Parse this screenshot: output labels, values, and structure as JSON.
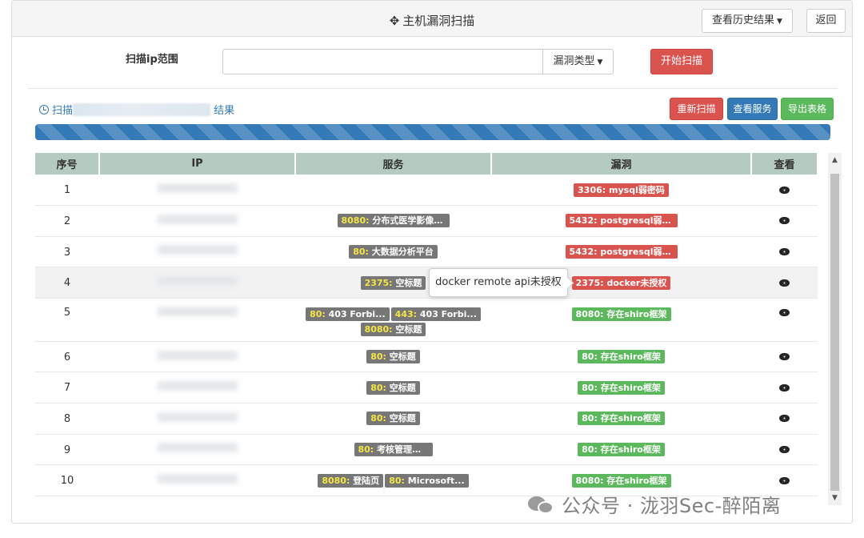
{
  "header": {
    "title": "主机漏洞扫描",
    "history_label": "查看历史结果",
    "back_label": "返回"
  },
  "scan_form": {
    "range_label": "扫描ip范围",
    "ip_value": "",
    "vuln_type_label": "漏洞类型",
    "start_label": "开始扫描"
  },
  "results": {
    "title_prefix": "扫描",
    "title_suffix": "结果",
    "rescan_label": "重新扫描",
    "services_label": "查看服务",
    "export_label": "导出表格",
    "progress_fraction": 1.0
  },
  "table": {
    "headers": [
      "序号",
      "IP",
      "服务",
      "漏洞",
      "查看"
    ],
    "rows": [
      {
        "idx": "1",
        "services": [],
        "vulns": [
          {
            "port": "3306:",
            "name": "mysql弱密码",
            "color": "red"
          }
        ]
      },
      {
        "idx": "2",
        "services": [
          {
            "port": "8080:",
            "name": "分布式医学影像平台"
          }
        ],
        "vulns": [
          {
            "port": "5432:",
            "name": "postgresql弱密码",
            "color": "red"
          }
        ]
      },
      {
        "idx": "3",
        "services": [
          {
            "port": "80:",
            "name": "大数据分析平台"
          }
        ],
        "vulns": [
          {
            "port": "5432:",
            "name": "postgresql弱密码",
            "color": "red"
          }
        ]
      },
      {
        "idx": "4",
        "services": [
          {
            "port": "2375:",
            "name": "空标题"
          }
        ],
        "vulns": [
          {
            "port": "2375:",
            "name": "docker未授权",
            "color": "red"
          }
        ]
      },
      {
        "idx": "5",
        "services": [
          {
            "port": "80:",
            "name": "403 Forbi..."
          },
          {
            "port": "443:",
            "name": "403 Forbi..."
          },
          {
            "port": "8080:",
            "name": "空标题"
          }
        ],
        "vulns": [
          {
            "port": "8080:",
            "name": "存在shiro框架",
            "color": "green"
          }
        ]
      },
      {
        "idx": "6",
        "services": [
          {
            "port": "80:",
            "name": "空标题"
          }
        ],
        "vulns": [
          {
            "port": "80:",
            "name": "存在shiro框架",
            "color": "green"
          }
        ]
      },
      {
        "idx": "7",
        "services": [
          {
            "port": "80:",
            "name": "空标题"
          }
        ],
        "vulns": [
          {
            "port": "80:",
            "name": "存在shiro框架",
            "color": "green"
          }
        ]
      },
      {
        "idx": "8",
        "services": [
          {
            "port": "80:",
            "name": "空标题"
          }
        ],
        "vulns": [
          {
            "port": "80:",
            "name": "存在shiro框架",
            "color": "green"
          }
        ]
      },
      {
        "idx": "9",
        "services": [
          {
            "port": "80:",
            "name": "考核管理平台"
          }
        ],
        "vulns": [
          {
            "port": "80:",
            "name": "存在shiro框架",
            "color": "green"
          }
        ]
      },
      {
        "idx": "10",
        "services": [
          {
            "port": "8080:",
            "name": "登陆页"
          },
          {
            "port": "80:",
            "name": "Microsoft..."
          }
        ],
        "vulns": [
          {
            "port": "8080:",
            "name": "存在shiro框架",
            "color": "green"
          }
        ]
      }
    ]
  },
  "tooltip": {
    "text": "docker remote api未授权"
  },
  "watermark": {
    "text": "公众号 · 泷羽Sec-醉陌离"
  },
  "colors": {
    "primary": "#337ab7",
    "danger": "#d9534f",
    "success": "#5cb85c",
    "label_gray": "#777777",
    "table_header": "#b6cbbf"
  }
}
